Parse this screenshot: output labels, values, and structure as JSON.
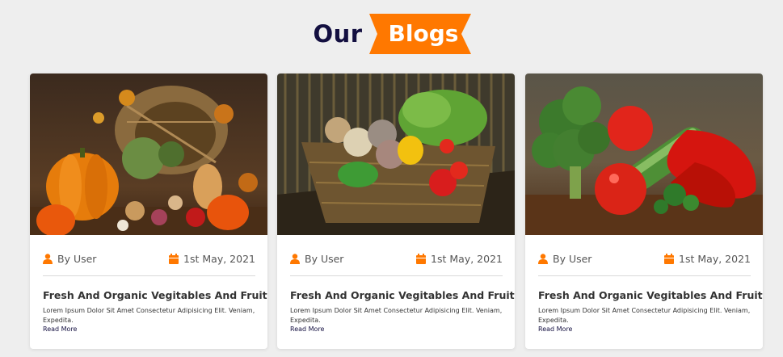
{
  "heading": {
    "plain": "Our",
    "highlight": "Blogs"
  },
  "colors": {
    "accent": "#ff7800",
    "heading_dark": "#130f40"
  },
  "cards": [
    {
      "image_desc_icon": "vegetables-basket-image",
      "author": "By User",
      "date": "1st May, 2021",
      "title": "Fresh And Organic Vegitables And Fruits",
      "description": "Lorem Ipsum Dolor Sit Amet Consectetur Adipisicing Elit. Veniam, Expedita.",
      "link": "Read More"
    },
    {
      "image_desc_icon": "vegetables-crate-image",
      "author": "By User",
      "date": "1st May, 2021",
      "title": "Fresh And Organic Vegitables And Fruits",
      "description": "Lorem Ipsum Dolor Sit Amet Consectetur Adipisicing Elit. Veniam, Expedita.",
      "link": "Read More"
    },
    {
      "image_desc_icon": "vegetables-table-image",
      "author": "By User",
      "date": "1st May, 2021",
      "title": "Fresh And Organic Vegitables And Fruits",
      "description": "Lorem Ipsum Dolor Sit Amet Consectetur Adipisicing Elit. Veniam, Expedita.",
      "link": "Read More"
    }
  ]
}
